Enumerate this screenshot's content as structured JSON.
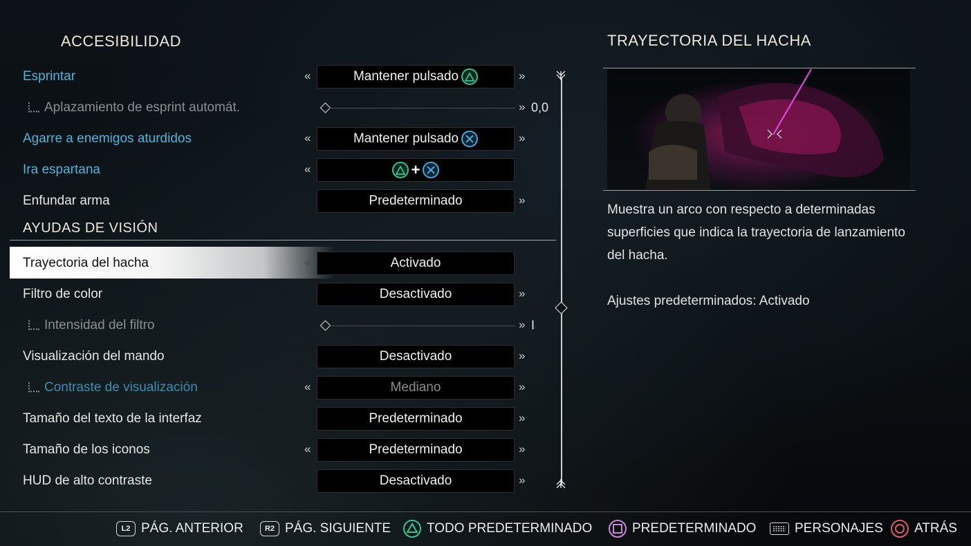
{
  "left_section_title": "ACCESIBILIDAD",
  "vision_section_title": "AYUDAS DE VISIÓN",
  "settings": [
    {
      "label": "Esprintar",
      "value": "Mantener pulsado",
      "icon": "triangle-icon"
    },
    {
      "label": "Aplazamiento de esprint automát.",
      "slider_value": "0,0"
    },
    {
      "label": "Agarre a enemigos aturdidos",
      "value": "Mantener pulsado",
      "icon": "cross-icon"
    },
    {
      "label": "Ira espartana",
      "combo_plus": "+"
    },
    {
      "label": "Enfundar arma",
      "value": "Predeterminado"
    }
  ],
  "vision_settings": [
    {
      "label": "Trayectoria del hacha",
      "value": "Activado"
    },
    {
      "label": "Filtro de color",
      "value": "Desactivado"
    },
    {
      "label": "Intensidad del filtro",
      "slider_value": "I"
    },
    {
      "label": "Visualización del mando",
      "value": "Desactivado"
    },
    {
      "label": "Contraste de visualización",
      "value": "Mediano"
    },
    {
      "label": "Tamaño del texto de la interfaz",
      "value": "Predeterminado"
    },
    {
      "label": "Tamaño de los iconos",
      "value": "Predeterminado"
    },
    {
      "label": "HUD de alto contraste",
      "value": "Desactivado"
    }
  ],
  "arrows": {
    "left": "«",
    "right": "»"
  },
  "detail": {
    "title": "TRAYECTORIA DEL HACHA",
    "description": "Muestra un arco con respecto a determinadas superficies que indica la trayectoria de lanzamiento del hacha.",
    "defaults": "Ajustes predeterminados: Activado"
  },
  "footer": [
    {
      "button": "L2",
      "label": "PÁG. ANTERIOR"
    },
    {
      "button": "R2",
      "label": "PÁG. SIGUIENTE"
    },
    {
      "button": "triangle",
      "label": "TODO PREDETERMINADO"
    },
    {
      "button": "square",
      "label": "PREDETERMINADO"
    },
    {
      "button": "touchpad",
      "label": "PERSONAJES"
    },
    {
      "button": "circle",
      "label": "ATRÁS"
    }
  ],
  "colors": {
    "highlight_text": "#4eb4d9",
    "triangle": "#35c48f",
    "cross": "#4aa7d9",
    "square": "#c989d6",
    "circle": "#e05c6c",
    "axe_trail": "#d64cd6"
  }
}
